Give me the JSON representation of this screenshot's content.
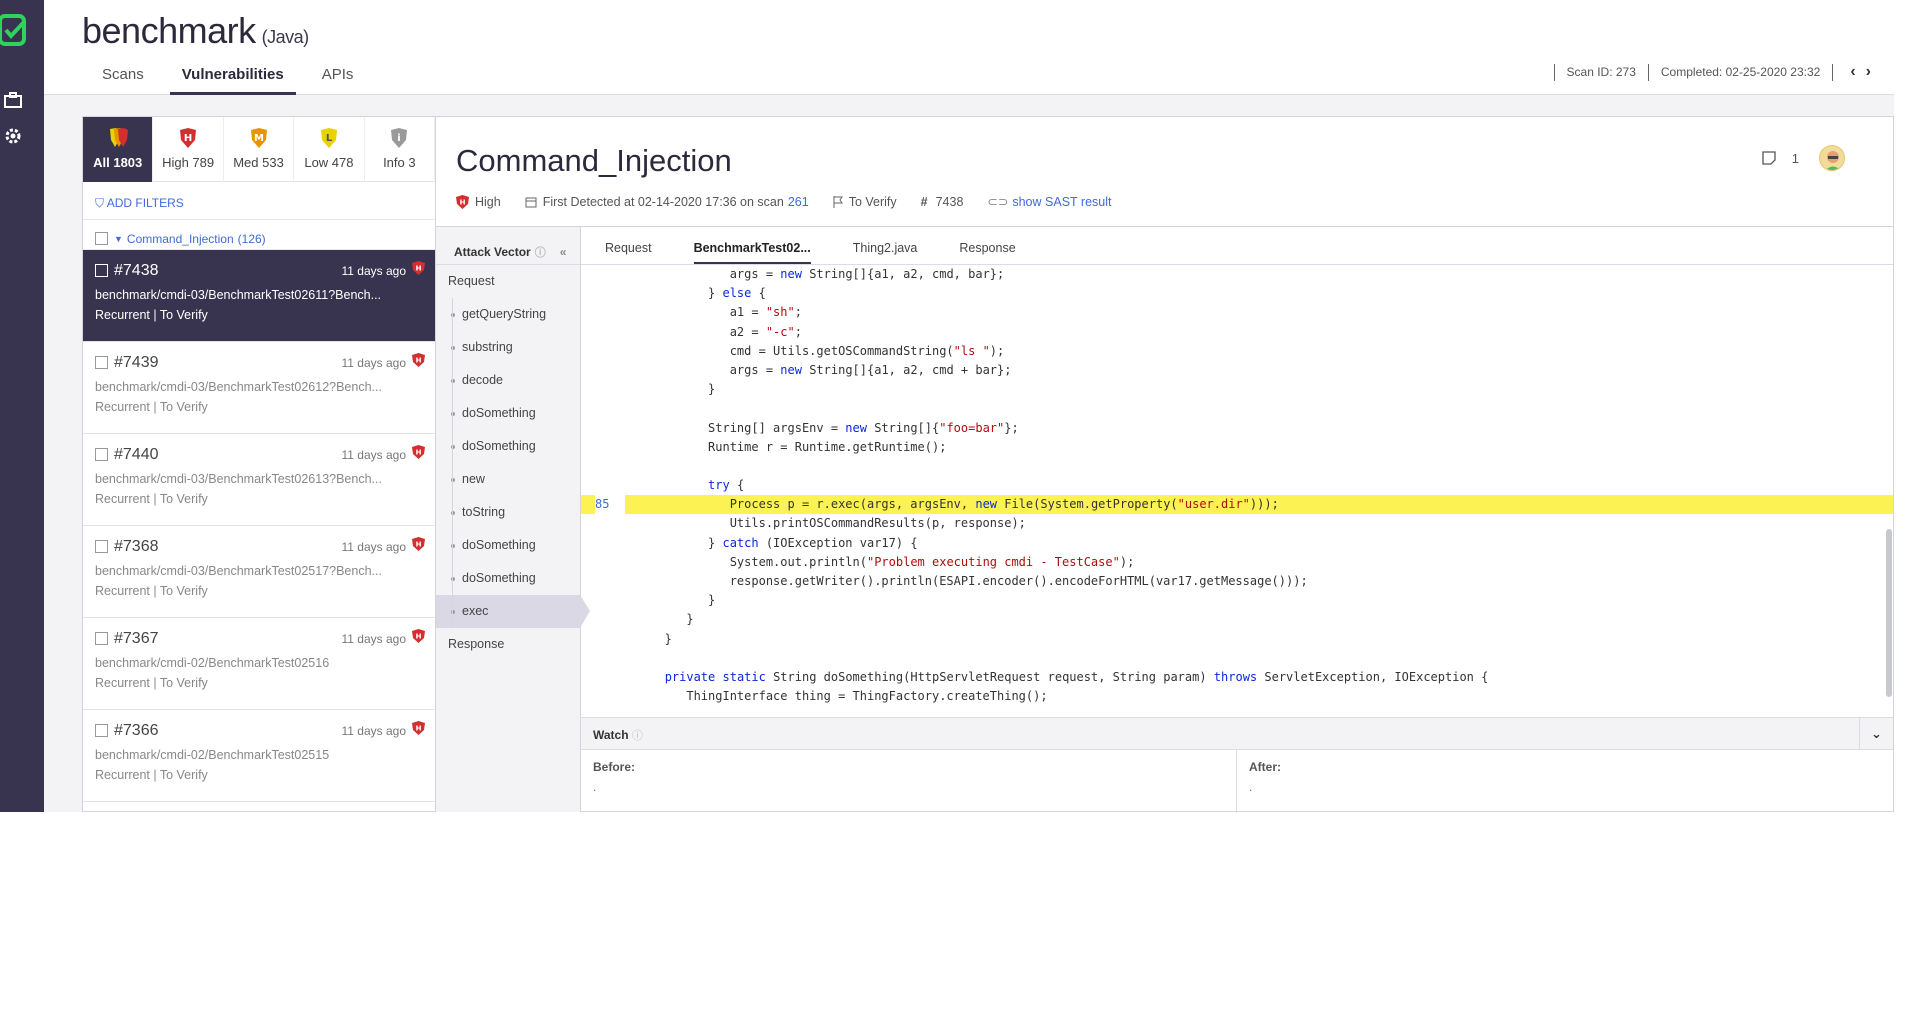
{
  "project": {
    "name": "benchmark",
    "language": "(Java)"
  },
  "tabs": [
    {
      "label": "Scans",
      "active": false
    },
    {
      "label": "Vulnerabilities",
      "active": true
    },
    {
      "label": "APIs",
      "active": false
    }
  ],
  "scan": {
    "id": "Scan ID: 273",
    "completed": "Completed: 02-25-2020 23:32"
  },
  "severity_tabs": [
    {
      "label": "All 1803",
      "color": "#d32f2f",
      "active": true
    },
    {
      "label": "High 789",
      "color": "#d32f2f",
      "letter": "H",
      "active": false
    },
    {
      "label": "Med 533",
      "color": "#e69500",
      "letter": "M",
      "active": false
    },
    {
      "label": "Low 478",
      "color": "#e8d200",
      "letter": "L",
      "active": false
    },
    {
      "label": "Info 3",
      "color": "#9a9a9a",
      "letter": "i",
      "active": false
    }
  ],
  "filters_label": "ADD FILTERS",
  "group": {
    "label": "Command_Injection",
    "count": "(126)"
  },
  "items": [
    {
      "id": "#7438",
      "ago": "11 days ago",
      "path": "benchmark/cmdi-03/BenchmarkTest02611?Bench...",
      "status": "Recurrent",
      "state": "To Verify",
      "selected": true
    },
    {
      "id": "#7439",
      "ago": "11 days ago",
      "path": "benchmark/cmdi-03/BenchmarkTest02612?Bench...",
      "status": "Recurrent",
      "state": "To Verify",
      "selected": false
    },
    {
      "id": "#7440",
      "ago": "11 days ago",
      "path": "benchmark/cmdi-03/BenchmarkTest02613?Bench...",
      "status": "Recurrent",
      "state": "To Verify",
      "selected": false
    },
    {
      "id": "#7368",
      "ago": "11 days ago",
      "path": "benchmark/cmdi-03/BenchmarkTest02517?Bench...",
      "status": "Recurrent",
      "state": "To Verify",
      "selected": false
    },
    {
      "id": "#7367",
      "ago": "11 days ago",
      "path": "benchmark/cmdi-02/BenchmarkTest02516",
      "status": "Recurrent",
      "state": "To Verify",
      "selected": false
    },
    {
      "id": "#7366",
      "ago": "11 days ago",
      "path": "benchmark/cmdi-02/BenchmarkTest02515",
      "status": "Recurrent",
      "state": "To Verify",
      "selected": false
    }
  ],
  "vuln": {
    "title": "Command_Injection",
    "severity": "High",
    "first_detected": "First Detected at 02-14-2020 17:36 on scan",
    "scan_link": "261",
    "state": "To Verify",
    "number": "7438",
    "sast_link": "show SAST result",
    "comments": "1"
  },
  "attack_vector": {
    "header": "Attack Vector",
    "request": "Request",
    "nodes": [
      "getQueryString",
      "substring",
      "decode",
      "doSomething",
      "doSomething",
      "new",
      "toString",
      "doSomething",
      "doSomething",
      "exec"
    ],
    "active_node": 9,
    "response": "Response"
  },
  "code_tabs": [
    {
      "label": "Request",
      "active": false
    },
    {
      "label": "BenchmarkTest02...",
      "active": true
    },
    {
      "label": "Thing2.java",
      "active": false
    },
    {
      "label": "Response",
      "active": false
    }
  ],
  "code_lines": [
    {
      "ln": "",
      "text": "            args = new String[]{a1, a2, cmd, bar};"
    },
    {
      "ln": "",
      "text": "         } else {"
    },
    {
      "ln": "",
      "text": "            a1 = \"sh\";"
    },
    {
      "ln": "",
      "text": "            a2 = \"-c\";"
    },
    {
      "ln": "",
      "text": "            cmd = Utils.getOSCommandString(\"ls \");"
    },
    {
      "ln": "",
      "text": "            args = new String[]{a1, a2, cmd + bar};"
    },
    {
      "ln": "",
      "text": "         }"
    },
    {
      "ln": "",
      "text": ""
    },
    {
      "ln": "",
      "text": "         String[] argsEnv = new String[]{\"foo=bar\"};"
    },
    {
      "ln": "",
      "text": "         Runtime r = Runtime.getRuntime();"
    },
    {
      "ln": "",
      "text": ""
    },
    {
      "ln": "",
      "text": "         try {"
    },
    {
      "ln": "85",
      "text": "            Process p = r.exec(args, argsEnv, new File(System.getProperty(\"user.dir\")));",
      "highlight": true
    },
    {
      "ln": "",
      "text": "            Utils.printOSCommandResults(p, response);"
    },
    {
      "ln": "",
      "text": "         } catch (IOException var17) {"
    },
    {
      "ln": "",
      "text": "            System.out.println(\"Problem executing cmdi - TestCase\");"
    },
    {
      "ln": "",
      "text": "            response.getWriter().println(ESAPI.encoder().encodeForHTML(var17.getMessage()));"
    },
    {
      "ln": "",
      "text": "         }"
    },
    {
      "ln": "",
      "text": "      }"
    },
    {
      "ln": "",
      "text": "   }"
    },
    {
      "ln": "",
      "text": ""
    },
    {
      "ln": "",
      "text": "   private static String doSomething(HttpServletRequest request, String param) throws ServletException, IOException {"
    },
    {
      "ln": "",
      "text": "      ThingInterface thing = ThingFactory.createThing();"
    }
  ],
  "watch": {
    "title": "Watch",
    "before": "Before:",
    "before_val": ".",
    "after": "After:",
    "after_val": "."
  }
}
